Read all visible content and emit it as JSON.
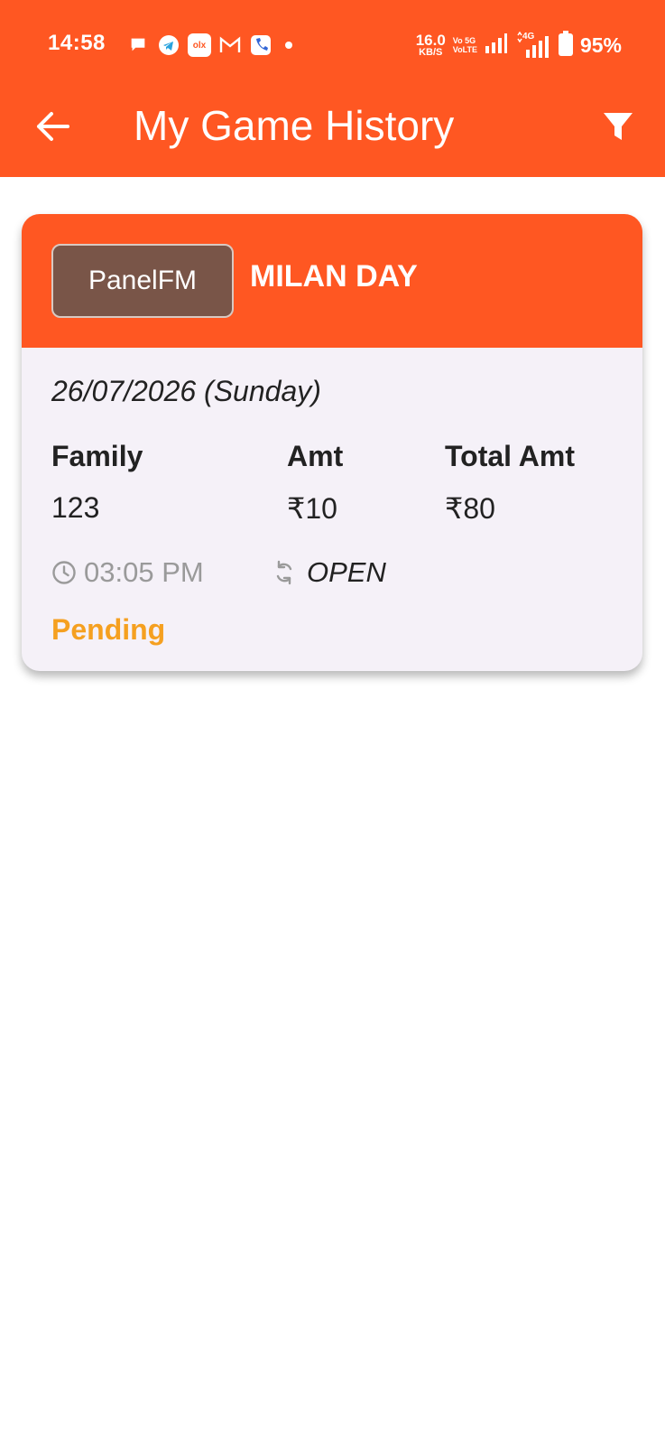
{
  "status_bar": {
    "time": "14:58",
    "net_speed_value": "16.0",
    "net_speed_unit": "KB/S",
    "volte_line1": "Vo 5G",
    "volte_line2": "VoLTE",
    "network_type": "4G",
    "battery": "95%"
  },
  "app_bar": {
    "title": "My Game History",
    "back_icon": "arrow-left-icon",
    "filter_icon": "filter-icon"
  },
  "history": [
    {
      "panel": "PanelFM",
      "market": "MILAN DAY",
      "date": "26/07/2026 (Sunday)",
      "columns": [
        {
          "label": "Family",
          "value": "123"
        },
        {
          "label": "Amt",
          "value": "₹10"
        },
        {
          "label": "Total Amt",
          "value": "₹80"
        }
      ],
      "time": "03:05 PM",
      "session": "OPEN",
      "status": "Pending"
    }
  ],
  "colors": {
    "primary": "#ff5722",
    "chip": "#795548",
    "card_background": "#f5f1f8",
    "pending": "#f5a020"
  }
}
